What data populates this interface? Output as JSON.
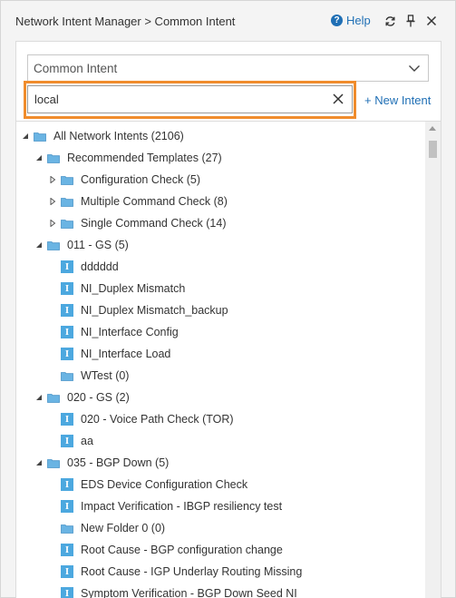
{
  "header": {
    "title": "Network Intent Manager > Common Intent",
    "help_label": "Help",
    "help_icon": "question-circle-icon",
    "refresh_icon": "refresh-icon",
    "pin_icon": "pin-icon",
    "close_icon": "close-icon"
  },
  "filter": {
    "selected": "Common Intent",
    "search_value": "local",
    "new_intent_label": "+ New Intent"
  },
  "colors": {
    "accent": "#1f6fb5",
    "search_highlight": "#f08c2c",
    "folder": "#5fa8d8",
    "intent_icon": "#4ca8df"
  },
  "tree": {
    "root": {
      "label": "All Network Intents (2106)"
    },
    "recommended": {
      "label": "Recommended Templates (27)"
    },
    "config_check": {
      "label": "Configuration Check (5)"
    },
    "multi_cmd": {
      "label": "Multiple Command Check (8)"
    },
    "single_cmd": {
      "label": "Single Command Check (14)"
    },
    "gs011": {
      "label": "011 - GS (5)"
    },
    "dddddd": {
      "label": "dddddd"
    },
    "ni_duplex": {
      "label": "NI_Duplex Mismatch"
    },
    "ni_duplex_backup": {
      "label": "NI_Duplex Mismatch_backup"
    },
    "ni_if_config": {
      "label": "NI_Interface Config"
    },
    "ni_if_load": {
      "label": "NI_Interface Load"
    },
    "wtest": {
      "label": "WTest (0)"
    },
    "gs020": {
      "label": "020 - GS (2)"
    },
    "voice_path": {
      "label": "020 - Voice Path Check (TOR)"
    },
    "aa": {
      "label": "aa"
    },
    "bgp_down": {
      "label": "035 - BGP Down (5)"
    },
    "eds_config": {
      "label": "EDS Device Configuration Check"
    },
    "impact_ibgp": {
      "label": "Impact Verification - IBGP resiliency test"
    },
    "new_folder": {
      "label": "New Folder 0 (0)"
    },
    "rc_bgp": {
      "label": "Root Cause - BGP configuration change"
    },
    "rc_igp": {
      "label": "Root Cause - IGP Underlay Routing Missing"
    },
    "sv_bgp": {
      "label": "Symptom Verification - BGP Down Seed NI"
    }
  }
}
